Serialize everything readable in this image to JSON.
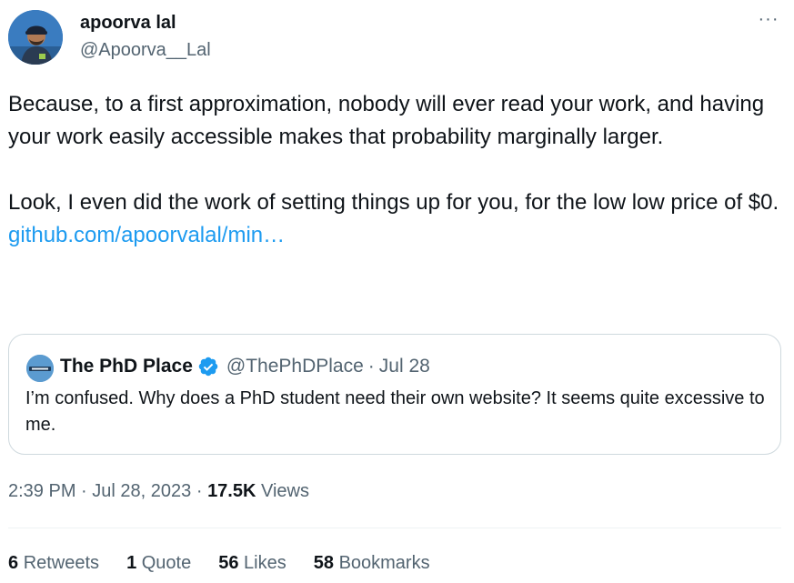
{
  "author": {
    "name": "apoorva lal",
    "handle": "@Apoorva__Lal"
  },
  "more_label": "···",
  "tweet": {
    "paragraph1": "Because, to a first approximation, nobody will ever read your work, and having your work easily accessible makes that probability marginally larger.",
    "paragraph2": "Look, I even did the work of setting things up for you, for the low low price of $0.",
    "link_text": "github.com/apoorvalal/min…"
  },
  "quote": {
    "name": "The PhD Place",
    "handle": "@ThePhDPlace",
    "separator": "·",
    "date": "Jul 28",
    "text": "I’m confused. Why does a PhD student need their own website? It seems quite excessive to me."
  },
  "meta": {
    "time": "2:39 PM",
    "separator": "·",
    "date": "Jul 28, 2023",
    "views_count": "17.5K",
    "views_label": "Views"
  },
  "stats": {
    "retweets_count": "6",
    "retweets_label": "Retweets",
    "quotes_count": "1",
    "quotes_label": "Quote",
    "likes_count": "56",
    "likes_label": "Likes",
    "bookmarks_count": "58",
    "bookmarks_label": "Bookmarks"
  },
  "colors": {
    "link": "#1d9bf0",
    "verified": "#1d9bf0",
    "secondary_text": "#536471",
    "primary_text": "#0f1419",
    "border": "#cfd9de"
  },
  "icons": {
    "more": "more-horizontal-icon",
    "verified": "verified-badge-icon"
  }
}
